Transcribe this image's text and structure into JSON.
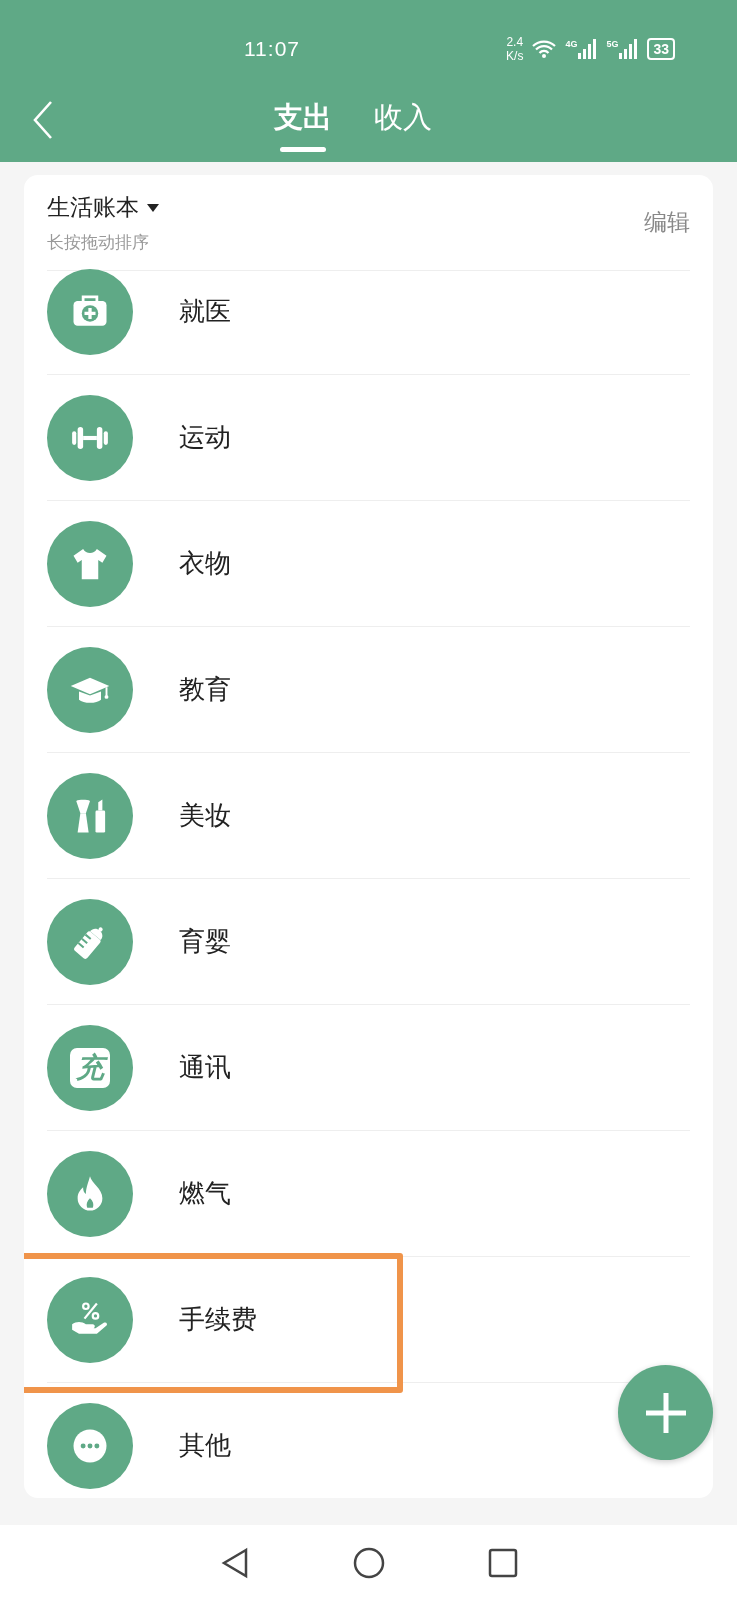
{
  "status_bar": {
    "time": "11:07",
    "speed_value": "2.4",
    "speed_unit": "K/s",
    "network_1": "4G",
    "network_2": "5G",
    "battery": "33"
  },
  "tabs": [
    {
      "label": "支出",
      "selected": true
    },
    {
      "label": "收入",
      "selected": false
    }
  ],
  "book": {
    "title": "生活账本",
    "hint": "长按拖动排序",
    "edit": "编辑"
  },
  "categories": [
    {
      "label": "就医",
      "kind": "medkit",
      "highlighted": false
    },
    {
      "label": "运动",
      "kind": "dumbbell",
      "highlighted": false
    },
    {
      "label": "衣物",
      "kind": "shirt",
      "highlighted": false
    },
    {
      "label": "教育",
      "kind": "cap",
      "highlighted": false
    },
    {
      "label": "美妆",
      "kind": "makeup",
      "highlighted": false
    },
    {
      "label": "育婴",
      "kind": "bottle",
      "highlighted": false
    },
    {
      "label": "通讯",
      "kind": "charge",
      "icon_text": "充",
      "highlighted": false
    },
    {
      "label": "燃气",
      "kind": "flame",
      "highlighted": false
    },
    {
      "label": "手续费",
      "kind": "fee",
      "highlighted": true
    },
    {
      "label": "其他",
      "kind": "more",
      "highlighted": false
    }
  ]
}
